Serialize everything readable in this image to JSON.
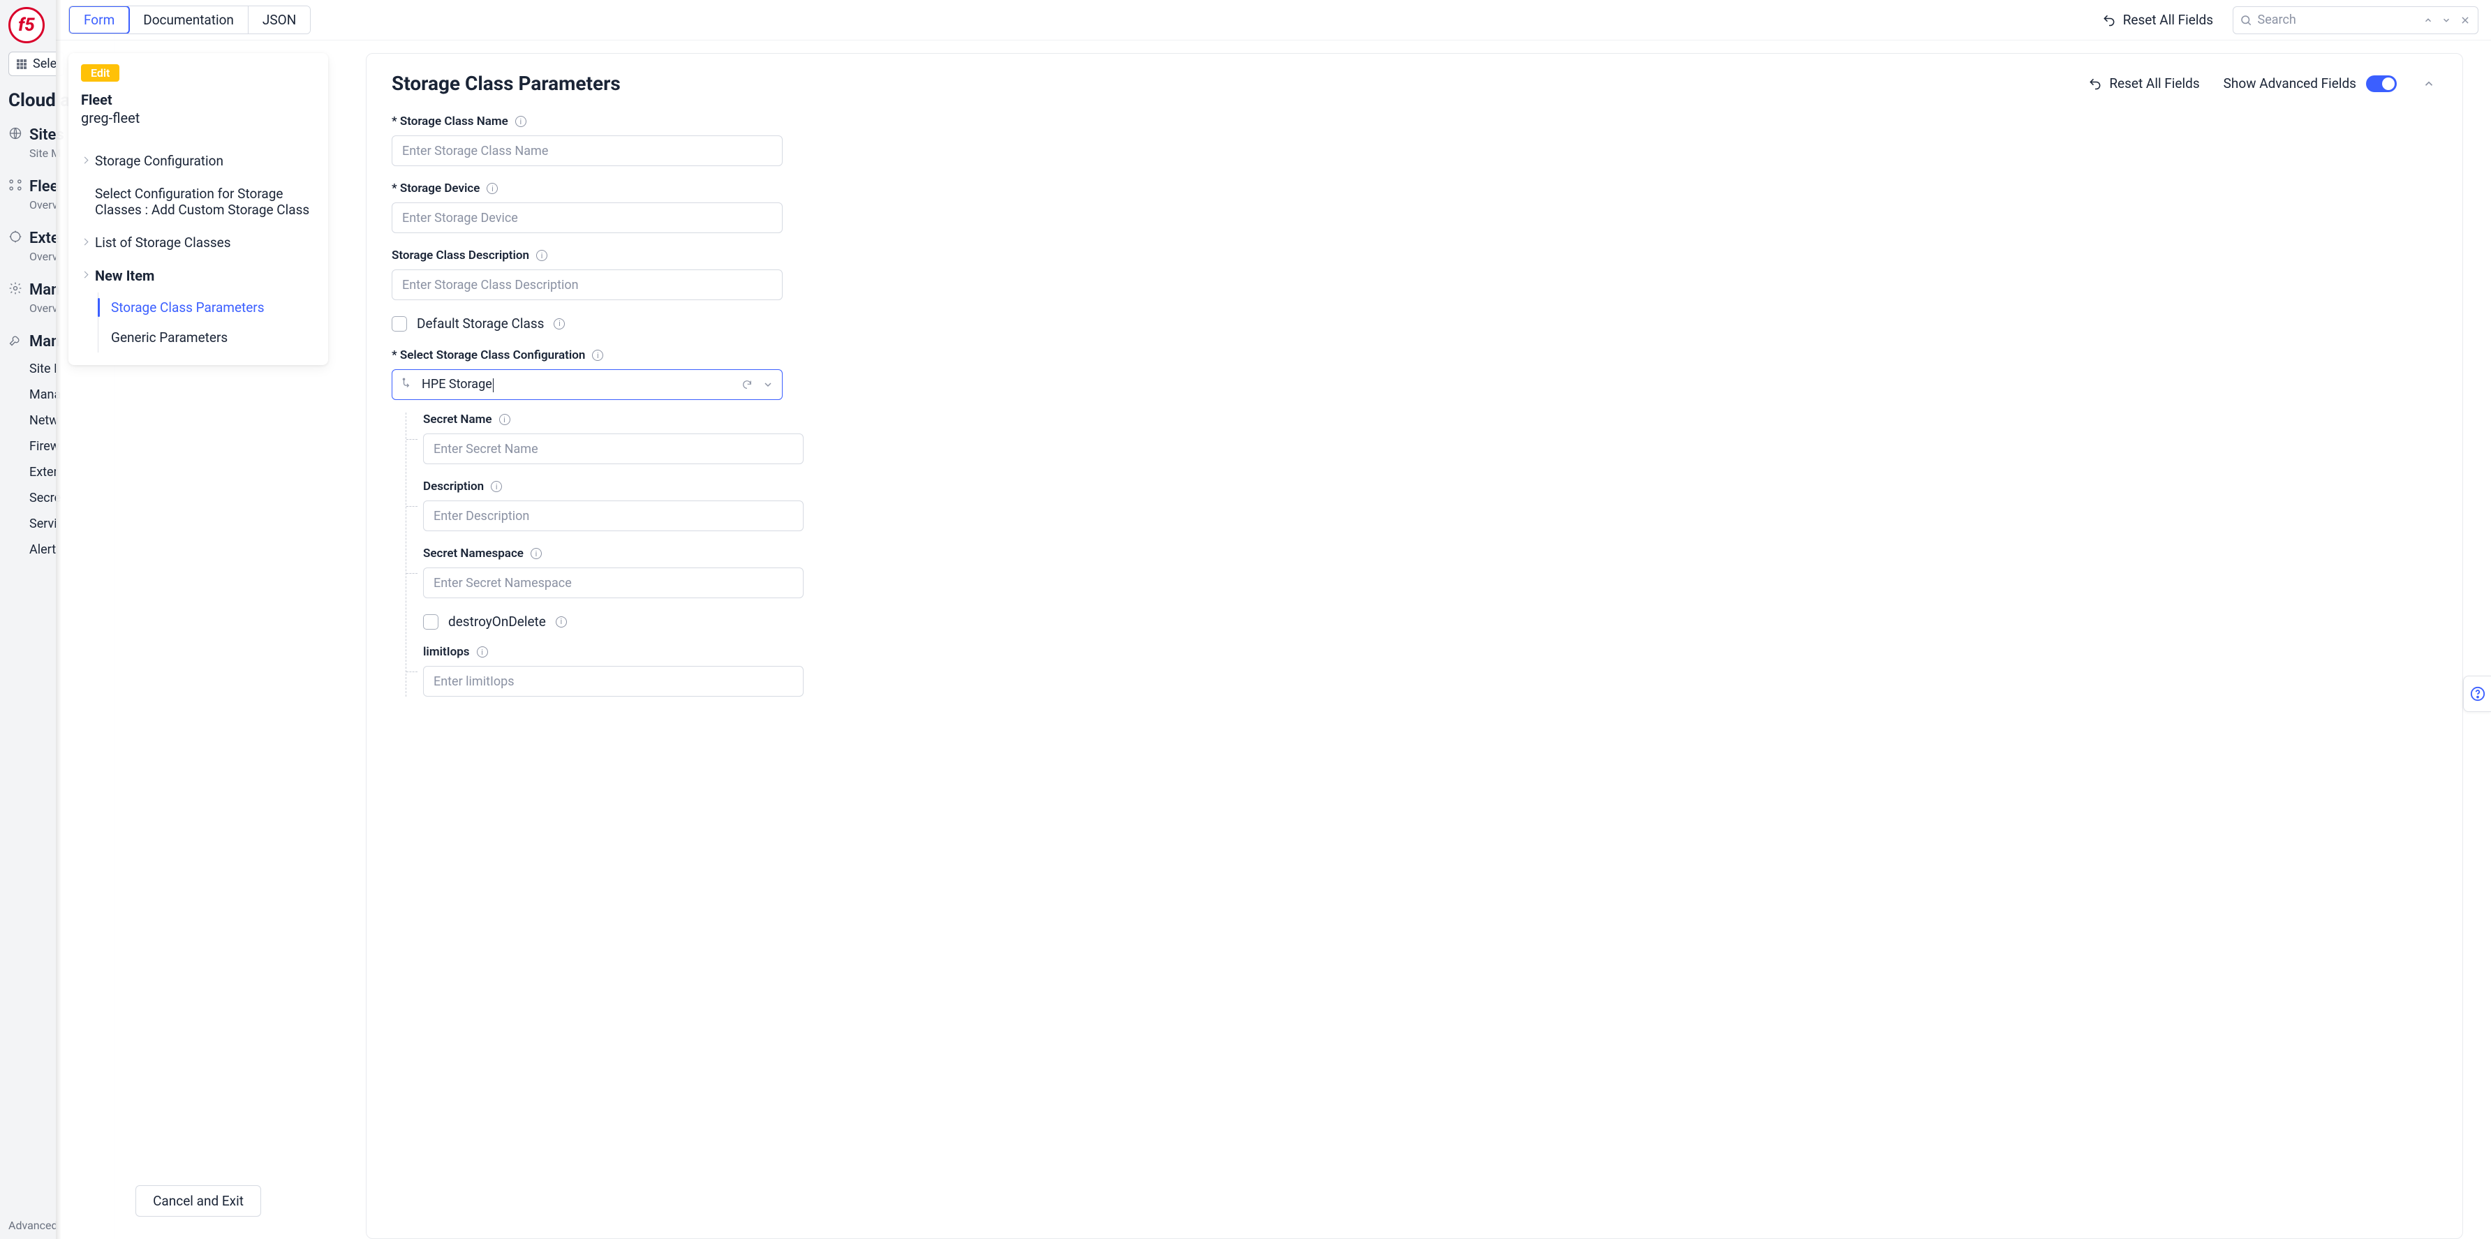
{
  "bg": {
    "logo_text": "f5",
    "select_btn": "Sele",
    "section_title": "Cloud a",
    "nav": [
      {
        "label": "Sites",
        "sub": "Site M"
      },
      {
        "label": "Flee",
        "sub": "Overv"
      },
      {
        "label": "Exte",
        "sub": "Overv"
      },
      {
        "label": "Man",
        "sub": "Overv"
      },
      {
        "label": "Man",
        "sub": ""
      }
    ],
    "subnav": [
      "Site I",
      "Mana",
      "Netw",
      "Firew",
      "Exter",
      "Secre",
      "Servi",
      "Alert"
    ],
    "advanced": "Advanced"
  },
  "topbar": {
    "tabs": {
      "form": "Form",
      "documentation": "Documentation",
      "json": "JSON"
    },
    "reset": "Reset All Fields",
    "search_placeholder": "Search"
  },
  "left": {
    "badge": "Edit",
    "fleet_label": "Fleet",
    "fleet_name": "greg-fleet",
    "tree": {
      "storage_config": "Storage Configuration",
      "select_config": "Select Configuration for Storage Classes : Add Custom Storage Class",
      "list_classes": "List of Storage Classes",
      "new_item": "New Item",
      "params": "Storage Class Parameters",
      "generic": "Generic Parameters"
    },
    "cancel": "Cancel and Exit"
  },
  "main": {
    "title": "Storage Class Parameters",
    "reset": "Reset All Fields",
    "show_adv": "Show Advanced Fields",
    "fields": {
      "name_label": "* Storage Class Name",
      "name_ph": "Enter Storage Class Name",
      "device_label": "* Storage Device",
      "device_ph": "Enter Storage Device",
      "desc_label": "Storage Class Description",
      "desc_ph": "Enter Storage Class Description",
      "default_label": "Default Storage Class",
      "sel_label": "* Select Storage Class Configuration",
      "sel_value": "HPE Storage",
      "secret_name_label": "Secret Name",
      "secret_name_ph": "Enter Secret Name",
      "description2_label": "Description",
      "description2_ph": "Enter Description",
      "secret_ns_label": "Secret Namespace",
      "secret_ns_ph": "Enter Secret Namespace",
      "destroy_label": "destroyOnDelete",
      "limitiops_label": "limitIops",
      "limitiops_ph": "Enter limitIops"
    }
  }
}
